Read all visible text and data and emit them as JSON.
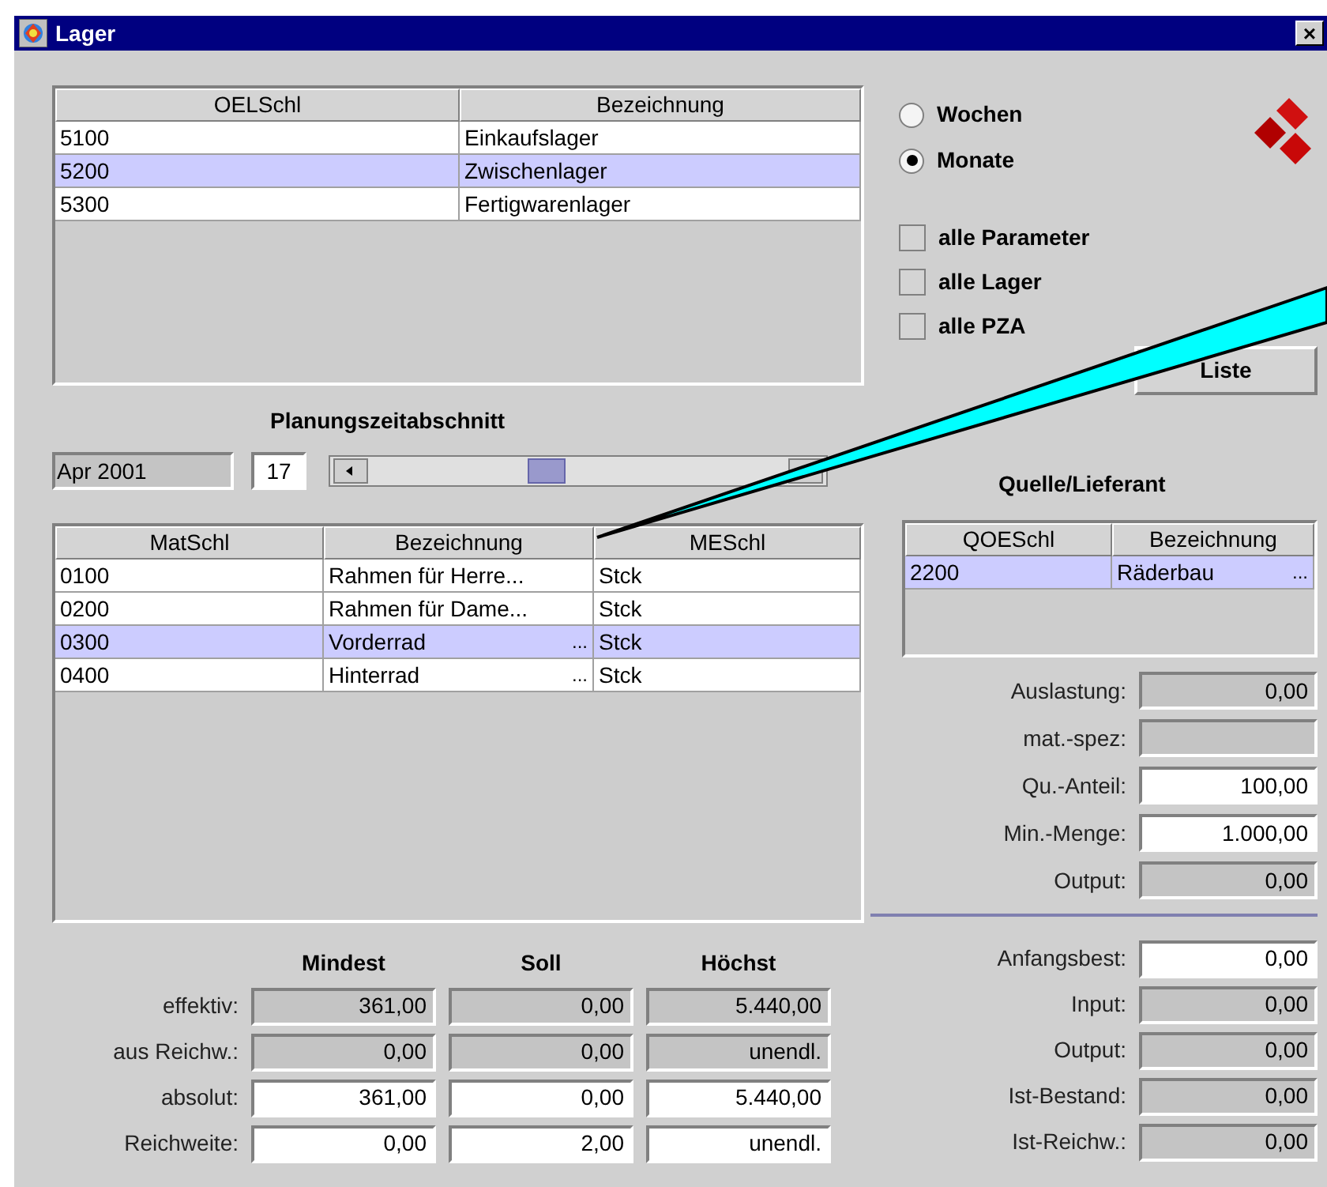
{
  "window": {
    "title": "Lager",
    "close": "×"
  },
  "lager_table": {
    "columns": [
      "OELSchl",
      "Bezeichnung"
    ],
    "rows": [
      {
        "cells": [
          "5100",
          "Einkaufslager"
        ],
        "selected": false
      },
      {
        "cells": [
          "5200",
          "Zwischenlager"
        ],
        "selected": true
      },
      {
        "cells": [
          "5300",
          "Fertigwarenlager"
        ],
        "selected": false
      }
    ]
  },
  "period_units": [
    {
      "label": "Wochen",
      "selected": false
    },
    {
      "label": "Monate",
      "selected": true
    }
  ],
  "options": [
    {
      "label": "alle Parameter",
      "checked": false
    },
    {
      "label": "alle Lager",
      "checked": false
    },
    {
      "label": "alle PZA",
      "checked": false
    }
  ],
  "list_button": "Liste",
  "planning": {
    "title": "Planungszeitabschnitt",
    "period": "Apr 2001",
    "number": "17",
    "level": 0.38
  },
  "material_table": {
    "columns": [
      "MatSchl",
      "Bezeichnung",
      "MESchl"
    ],
    "rows": [
      {
        "cells": [
          "0100",
          "Rahmen für Herre...",
          "Stck"
        ],
        "more": null,
        "selected": false
      },
      {
        "cells": [
          "0200",
          "Rahmen für Dame...",
          "Stck"
        ],
        "more": null,
        "selected": false
      },
      {
        "cells": [
          "0300",
          "Vorderrad",
          "Stck"
        ],
        "more": "...",
        "selected": true
      },
      {
        "cells": [
          "0400",
          "Hinterrad",
          "Stck"
        ],
        "more": "...",
        "selected": false
      }
    ]
  },
  "source": {
    "title": "Quelle/Lieferant",
    "table": {
      "columns": [
        "QOESchl",
        "Bezeichnung"
      ],
      "rows": [
        {
          "cells": [
            "2200",
            "Räderbau"
          ],
          "more": "...",
          "selected": true
        }
      ]
    },
    "fields": [
      {
        "label": "Auslastung:",
        "value": "0,00",
        "disabled": true
      },
      {
        "label": "mat.-spez:",
        "disabled": true
      },
      {
        "label": "Qu.-Anteil:",
        "value": "100,00",
        "disabled": false
      },
      {
        "label": "Min.-Menge:",
        "value": "1.000,00",
        "disabled": false
      },
      {
        "label": "Output:",
        "value": "0,00",
        "disabled": true
      }
    ]
  },
  "limits": {
    "columns": [
      "Mindest",
      "Soll",
      "Höchst"
    ],
    "rows": [
      {
        "label": "effektiv:",
        "values": [
          {
            "value": "361,00",
            "disabled": true
          },
          {
            "value": "0,00",
            "disabled": true
          },
          {
            "value": "5.440,00",
            "disabled": true
          }
        ]
      },
      {
        "label": "aus Reichw.:",
        "values": [
          {
            "value": "0,00",
            "disabled": true
          },
          {
            "value": "0,00",
            "disabled": true
          },
          {
            "value": "unendl.",
            "disabled": true
          }
        ]
      },
      {
        "label": "absolut:",
        "values": [
          {
            "value": "361,00",
            "disabled": false
          },
          {
            "value": "0,00",
            "disabled": false
          },
          {
            "value": "5.440,00",
            "disabled": false
          }
        ]
      },
      {
        "label": "Reichweite:",
        "values": [
          {
            "value": "0,00",
            "disabled": false
          },
          {
            "value": "2,00",
            "disabled": false
          },
          {
            "value": "unendl.",
            "disabled": false
          }
        ]
      }
    ]
  },
  "stock": [
    {
      "label": "Anfangsbest:",
      "value": "0,00",
      "disabled": false
    },
    {
      "label": "Input:",
      "value": "0,00",
      "disabled": true
    },
    {
      "label": "Output:",
      "value": "0,00",
      "disabled": true
    },
    {
      "label": "Ist-Bestand:",
      "value": "0,00",
      "disabled": true
    },
    {
      "label": "Ist-Reichw.:",
      "value": "0,00",
      "disabled": true
    }
  ]
}
